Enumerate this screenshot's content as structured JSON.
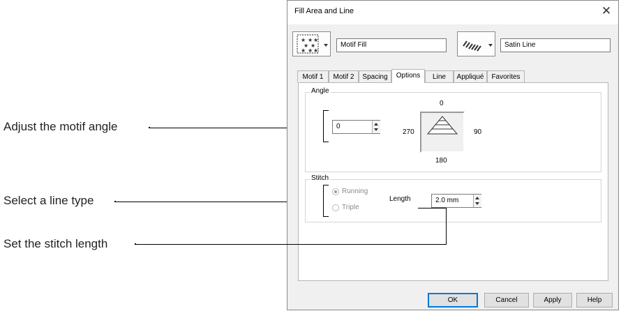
{
  "callouts": {
    "angle": "Adjust the motif angle",
    "line_type": "Select a line type",
    "stitch_length": "Set the stitch length"
  },
  "dialog": {
    "title": "Fill Area and Line",
    "fill_name": "Motif Fill",
    "line_name": "Satin Line",
    "tabs": [
      {
        "label": "Motif 1",
        "active": false
      },
      {
        "label": "Motif 2",
        "active": false
      },
      {
        "label": "Spacing",
        "active": false
      },
      {
        "label": "Options",
        "active": true
      },
      {
        "label": "Line",
        "active": false
      },
      {
        "label": "Appliqué",
        "active": false
      },
      {
        "label": "Favorites",
        "active": false
      }
    ],
    "angle": {
      "group_label": "Angle",
      "value": "0",
      "dial_top": "0",
      "dial_left": "270",
      "dial_right": "90",
      "dial_bottom": "180"
    },
    "stitch": {
      "group_label": "Stitch",
      "options": [
        {
          "label": "Running",
          "selected": true
        },
        {
          "label": "Triple",
          "selected": false
        }
      ],
      "length_label": "Length",
      "length_value": "2.0 mm"
    },
    "buttons": {
      "ok": "OK",
      "cancel": "Cancel",
      "apply": "Apply",
      "help": "Help"
    },
    "icons": {
      "fill": "star-motif-fill-icon",
      "line": "satin-line-icon",
      "close": "close-icon"
    }
  }
}
